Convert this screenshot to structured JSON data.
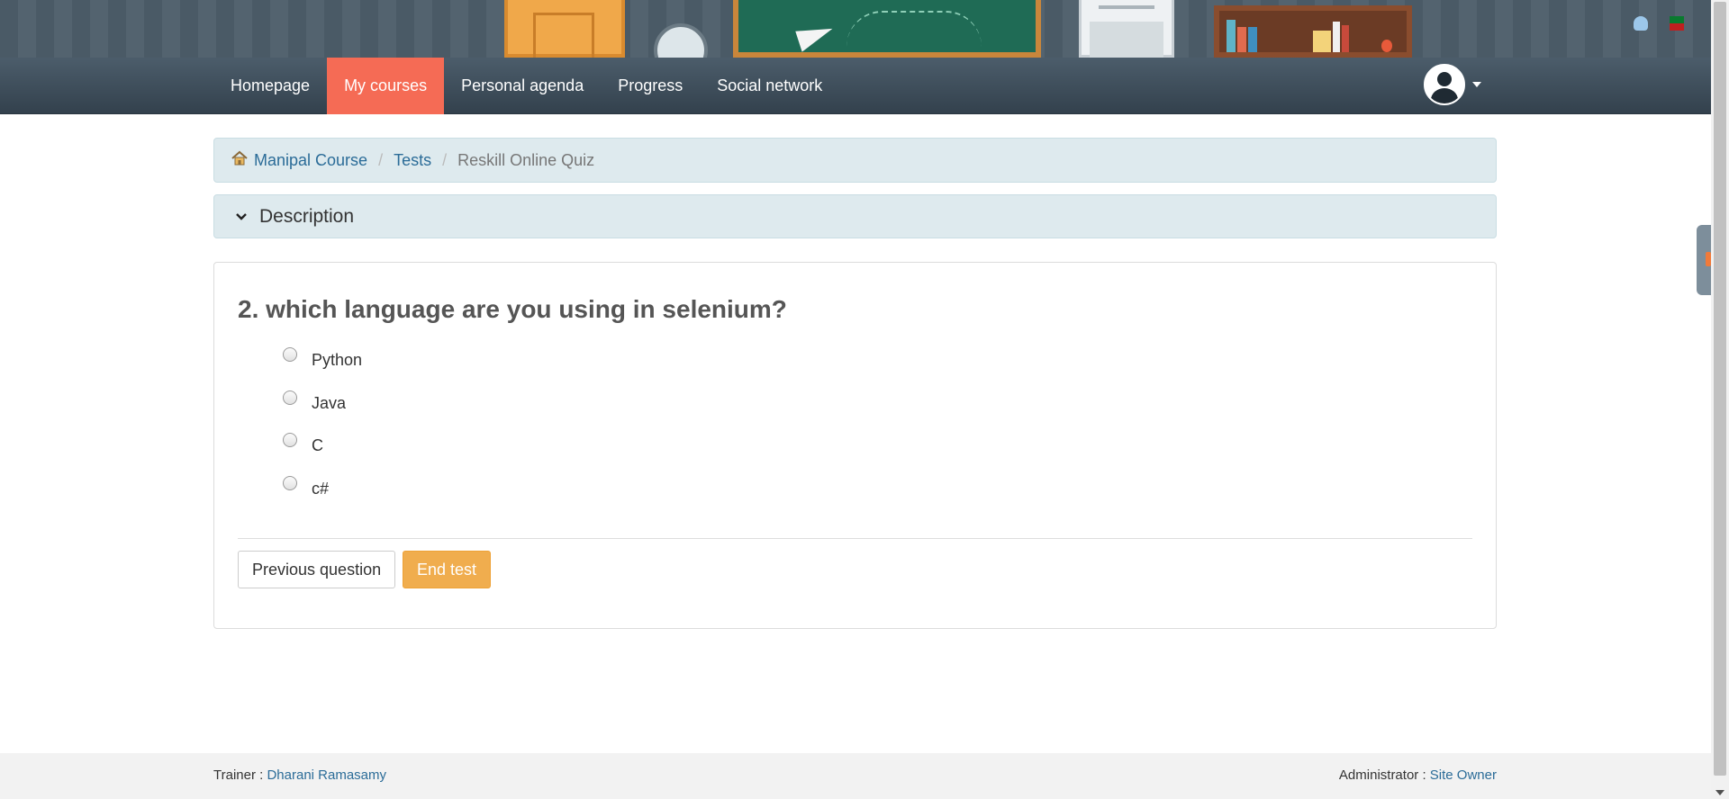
{
  "nav": {
    "items": [
      {
        "label": "Homepage",
        "active": false
      },
      {
        "label": "My courses",
        "active": true
      },
      {
        "label": "Personal agenda",
        "active": false
      },
      {
        "label": "Progress",
        "active": false
      },
      {
        "label": "Social network",
        "active": false
      }
    ],
    "active_color": "#f56b55"
  },
  "breadcrumb": {
    "course": "Manipal Course",
    "section": "Tests",
    "current": "Reskill Online Quiz"
  },
  "description": {
    "label": "Description"
  },
  "question": {
    "title": "2. which language are you using in selenium?",
    "options": [
      "Python",
      "Java",
      "C",
      "c#"
    ],
    "selected": null
  },
  "buttons": {
    "previous": "Previous question",
    "end": "End test"
  },
  "footer": {
    "trainer_label": "Trainer :",
    "trainer_name": "Dharani Ramasamy",
    "admin_label": "Administrator :",
    "admin_name": "Site Owner"
  },
  "icons": {
    "home": "home-icon",
    "chevron": "chevron-down-icon",
    "avatar": "user-avatar-icon",
    "user_lang": "user-icon",
    "flag": "flag-icon"
  },
  "colors": {
    "navbar_dark": "#33414d",
    "panel_bg": "#deeaee",
    "end_button": "#f0ad4e",
    "link": "#2b6c98"
  }
}
